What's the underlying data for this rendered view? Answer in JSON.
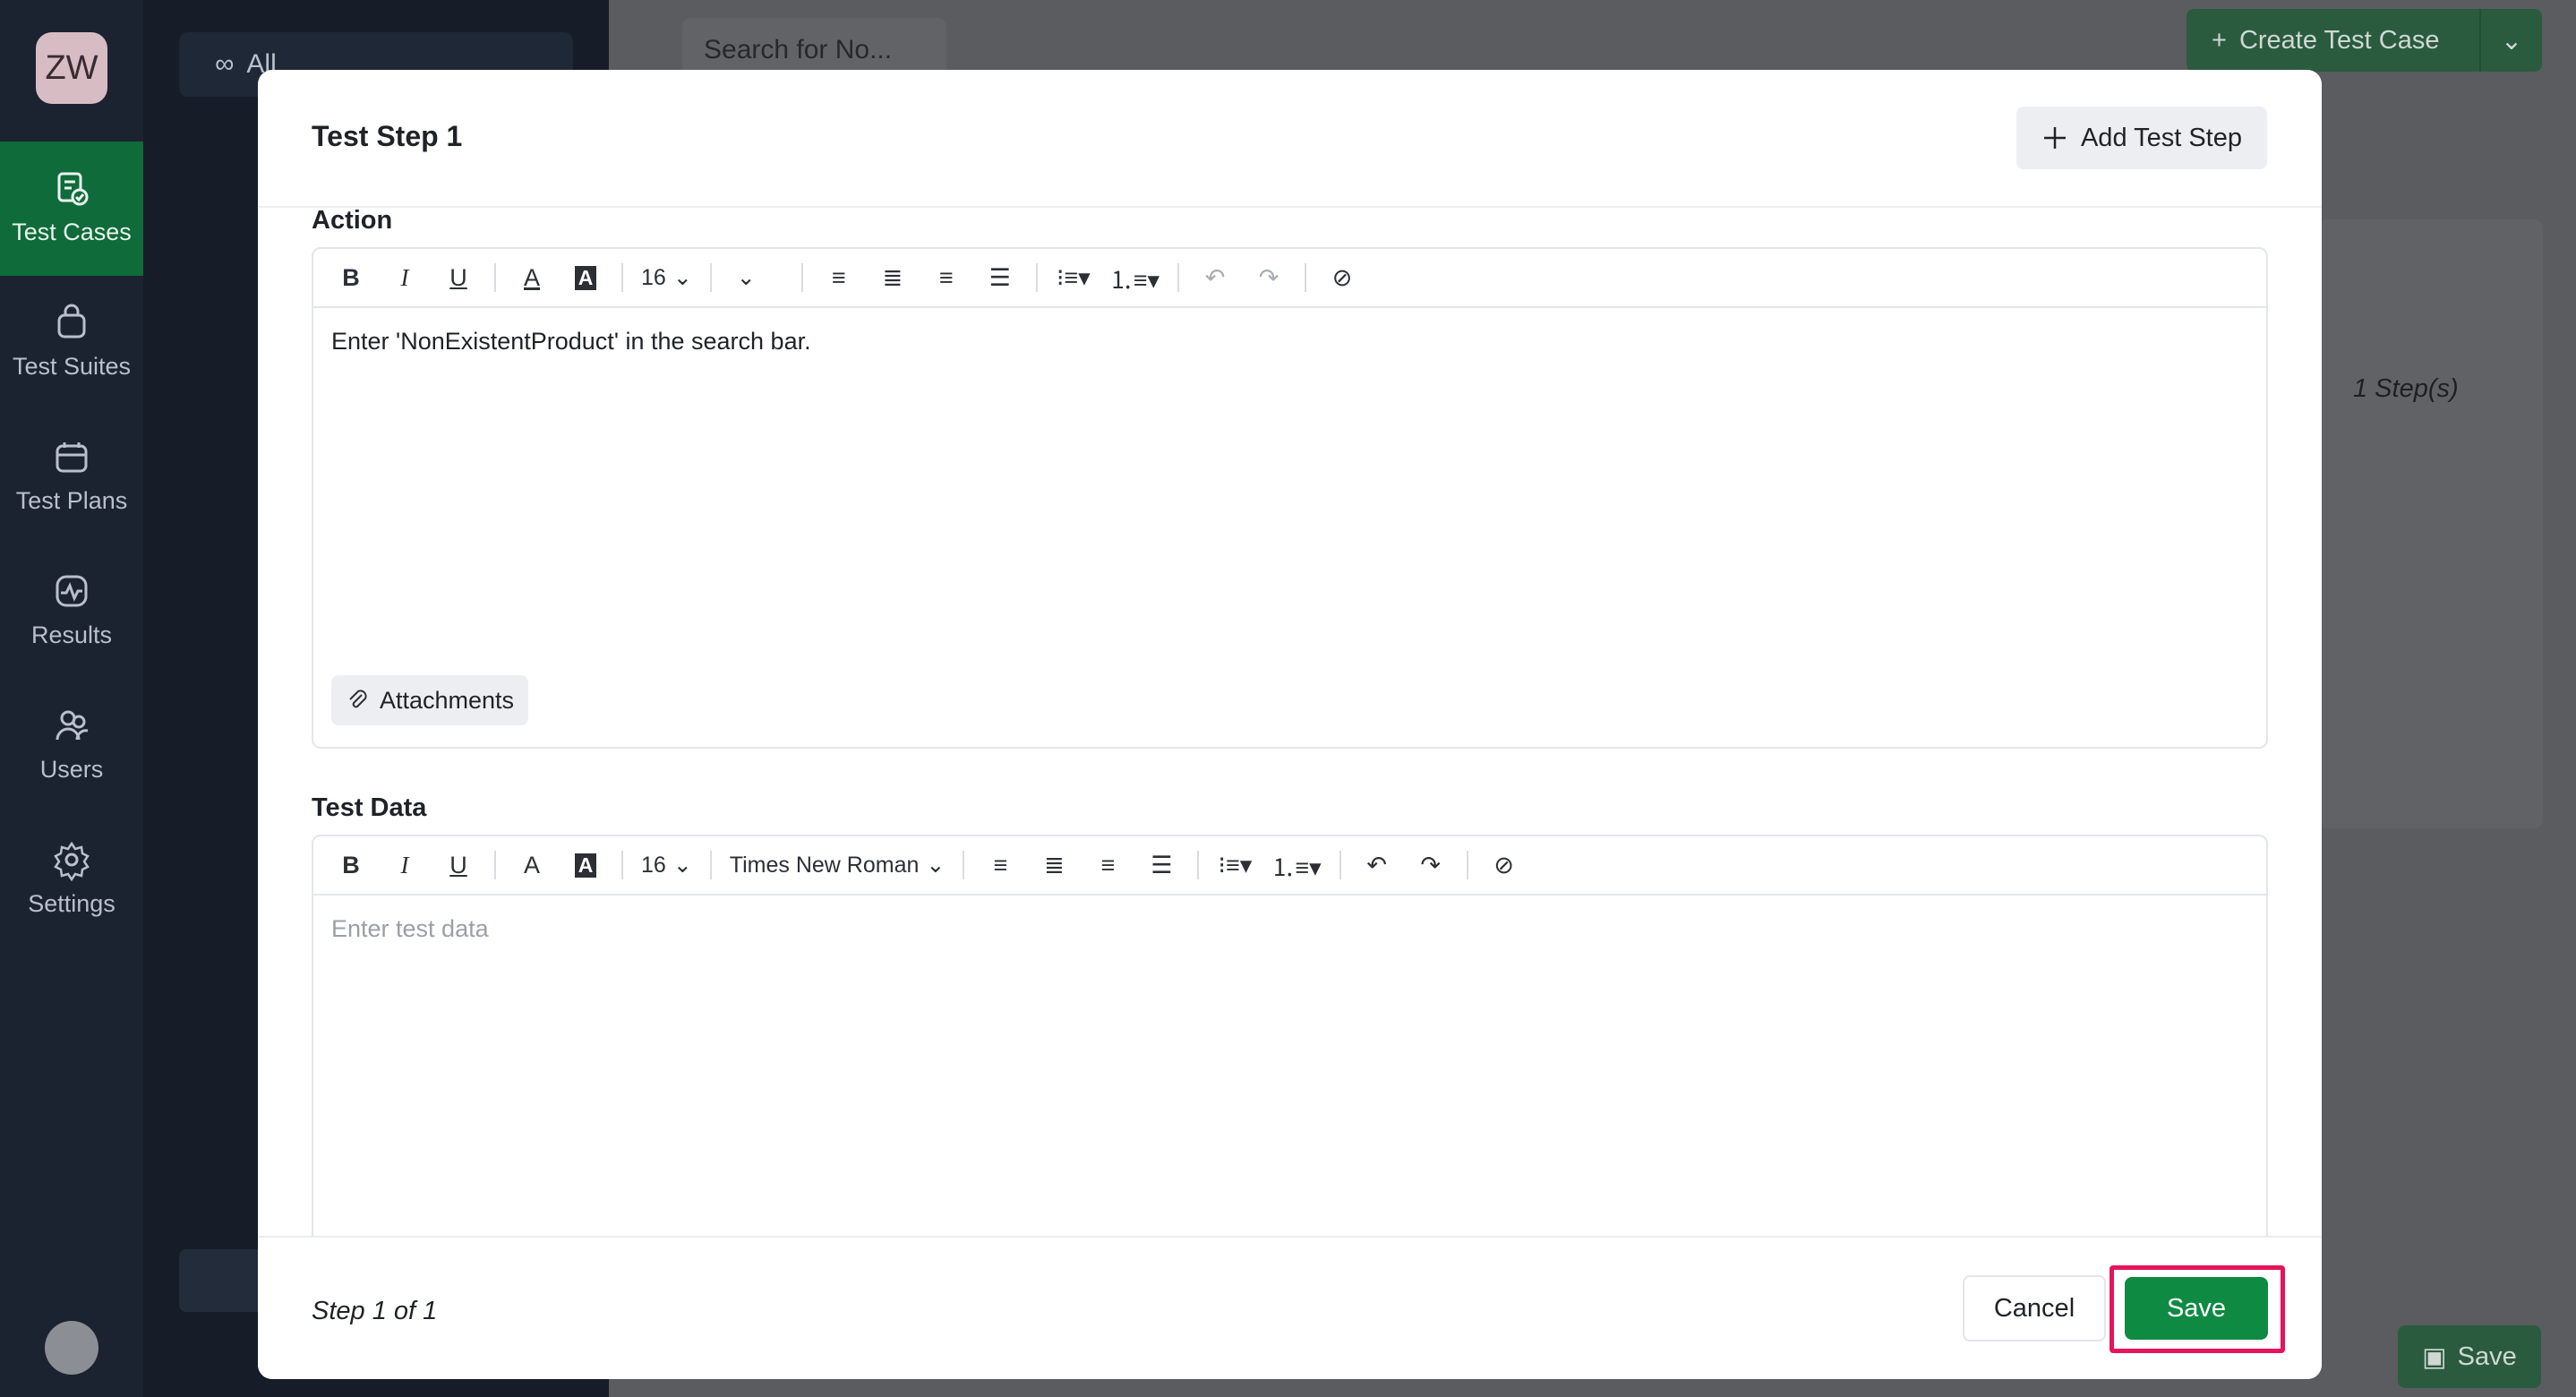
{
  "app": {
    "user_initials": "ZW",
    "nav": [
      {
        "label": "Test Cases",
        "icon": "test-cases-icon",
        "active": true
      },
      {
        "label": "Test Suites",
        "icon": "test-suites-icon",
        "active": false
      },
      {
        "label": "Test Plans",
        "icon": "test-plans-icon",
        "active": false
      },
      {
        "label": "Results",
        "icon": "results-icon",
        "active": false
      },
      {
        "label": "Users",
        "icon": "users-icon",
        "active": false
      },
      {
        "label": "Settings",
        "icon": "settings-icon",
        "active": false
      }
    ],
    "filter_label": "All",
    "search_placeholder": "Search for No...",
    "create_button_label": "Create Test Case",
    "steps_count_label": "1 Step(s)",
    "background_save_label": "Save"
  },
  "modal": {
    "title": "Test Step 1",
    "add_step_label": "Add Test Step",
    "action": {
      "label": "Action",
      "font_size": "16",
      "font_family": "",
      "content": "Enter 'NonExistentProduct' in the search bar.",
      "attachments_label": "Attachments"
    },
    "test_data": {
      "label": "Test Data",
      "font_size": "16",
      "font_family": "Times New Roman",
      "placeholder": "Enter test data",
      "content": ""
    },
    "footer": {
      "step_indicator": "Step 1 of 1",
      "cancel_label": "Cancel",
      "save_label": "Save"
    }
  },
  "colors": {
    "primary_green": "#0f8a43",
    "highlight": "#e6145a",
    "nav_active": "#0f6b3a"
  }
}
